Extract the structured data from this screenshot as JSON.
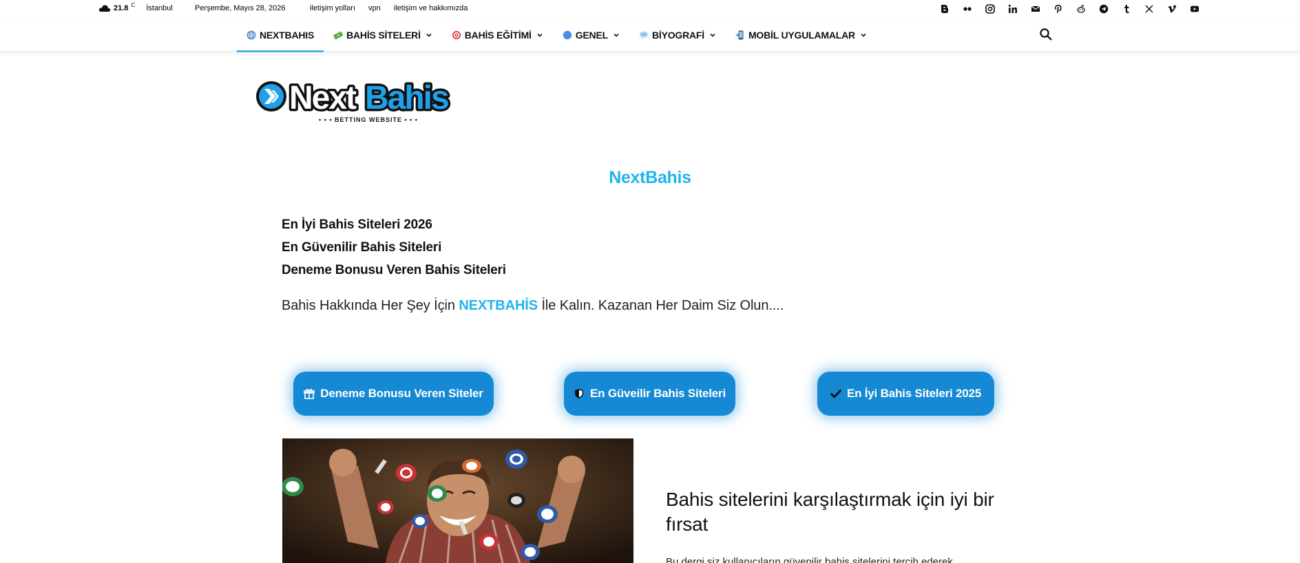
{
  "topbar": {
    "temperature": "21.8",
    "temperature_unit": "C",
    "city": "İstanbul",
    "date": "Perşembe, Mayıs 28, 2026",
    "links": [
      "iletişim yolları",
      "vpn",
      "iletişim ve hakkımızda"
    ],
    "social_icons": [
      "blogger-icon",
      "flickr-icon",
      "instagram-icon",
      "linkedin-icon",
      "mail-icon",
      "pinterest-icon",
      "reddit-icon",
      "telegram-icon",
      "tumblr-icon",
      "x-icon",
      "vimeo-icon",
      "youtube-icon"
    ]
  },
  "nav": {
    "items": [
      {
        "label": "NEXTBAHIS",
        "icon": "globe-icon",
        "active": true,
        "dropdown": false
      },
      {
        "label": "BAHİS SİTELERİ",
        "icon": "money-icon",
        "active": false,
        "dropdown": true
      },
      {
        "label": "BAHİS EĞİTİMİ",
        "icon": "target-icon",
        "active": false,
        "dropdown": true
      },
      {
        "label": "GENEL",
        "icon": "circle-icon",
        "active": false,
        "dropdown": true
      },
      {
        "label": "BİYOGRAFİ",
        "icon": "speech-icon",
        "active": false,
        "dropdown": true
      },
      {
        "label": "MOBİL UYGULAMALAR",
        "icon": "phone-icon",
        "active": false,
        "dropdown": true
      }
    ],
    "search_icon": "search-icon"
  },
  "logo": {
    "text_next": "Next",
    "text_bahis": "Bahis",
    "subtitle": "• • •  BETTING WEBSITE  • • •"
  },
  "main": {
    "site_title": "NextBahis",
    "list": [
      "En İyi Bahis Siteleri 2026",
      "En Güvenilir Bahis Siteleri",
      "Deneme Bonusu Veren Bahis Siteleri"
    ],
    "tagline_before": "Bahis Hakkında Her Şey İçin ",
    "tagline_brand": "NEXTBAHİS",
    "tagline_after": " İle Kalın. Kazanan Her Daim Siz Olun....",
    "buttons": [
      {
        "label": "Deneme Bonusu Veren Siteler",
        "icon": "gift-icon"
      },
      {
        "label": "En Güveilir Bahis Siteleri",
        "icon": "shield-icon"
      },
      {
        "label": "En İyi Bahis Siteleri 2025",
        "icon": "check-icon"
      }
    ],
    "article_title": "Bahis sitelerini karşılaştırmak için iyi bir fırsat",
    "article_excerpt": "Bu dergi siz kullanıcıların güvenilir bahis sitelerini tercih ederek"
  },
  "colors": {
    "accent": "#1fb4ee",
    "button": "#1589d4",
    "nav_active": "#4db2ec"
  }
}
